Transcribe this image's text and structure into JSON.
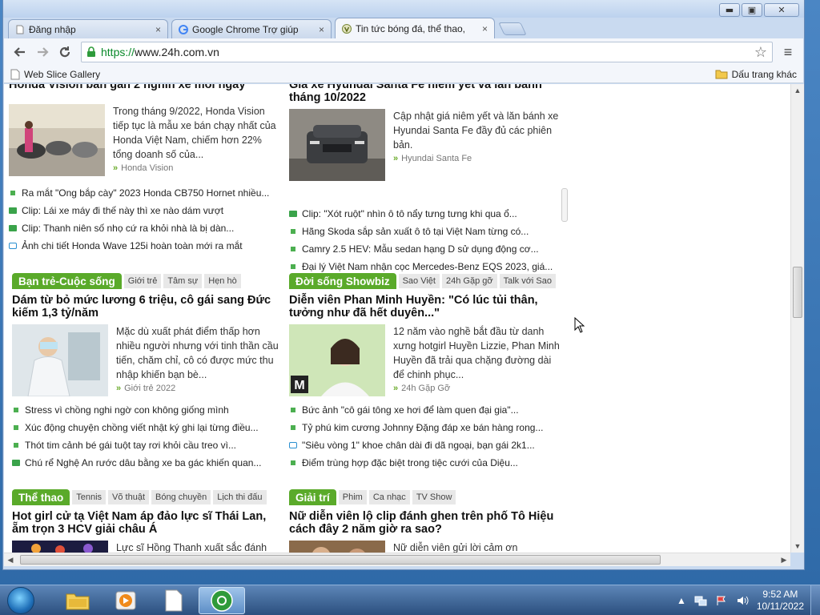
{
  "browser": {
    "tabs": [
      {
        "title": "Đăng nhập",
        "close": "×"
      },
      {
        "title": "Google Chrome Trợ giúp",
        "close": "×"
      },
      {
        "title": "Tin tức bóng đá, thể thao,",
        "close": "×"
      }
    ],
    "url": {
      "scheme": "https://",
      "host": "www.24h.com.vn"
    },
    "bookmarks": {
      "left": "Web Slice Gallery",
      "right": "Dấu trang khác"
    },
    "window_controls": {
      "min": "▬",
      "max": "▣",
      "close": "✕"
    }
  },
  "page": {
    "left_top": {
      "cut_title": "Honda Vision bán gần 2 nghìn xe mỗi ngày",
      "lead": "Trong tháng 9/2022, Honda Vision tiếp tục là mẫu xe bán chạy nhất của Honda Việt Nam, chiếm hơn 22% tổng doanh số của...",
      "tag": "Honda Vision",
      "links": [
        "Ra mắt \"Ong bắp cày\" 2023 Honda CB750 Hornet nhiều...",
        "Clip: Lái xe máy đi thế này thì xe nào dám vượt",
        "Clip: Thanh niên số nhọ cứ ra khỏi nhà là bị dàn...",
        "Ảnh chi tiết Honda Wave 125i hoàn toàn mới ra mắt"
      ]
    },
    "right_top": {
      "cut_title_1": "Giá xe Hyundai Santa Fe niêm yết và lăn bánh",
      "cut_title_2": "tháng 10/2022",
      "lead": "Cập nhật giá niêm yết và lăn bánh xe Hyundai Santa Fe đầy đủ các phiên bản.",
      "tag": "Hyundai Santa Fe",
      "links": [
        "Clip: \"Xót ruột\" nhìn ô tô nẩy tưng tưng khi qua ổ...",
        "Hãng Skoda sắp sản xuất ô tô tại Việt Nam từng có...",
        "Camry 2.5 HEV: Mẫu sedan hạng D sử dụng động cơ...",
        "Đại lý Việt Nam nhận cọc Mercedes-Benz EQS 2023, giá..."
      ]
    },
    "left_mid": {
      "section": "Bạn trẻ-Cuộc sống",
      "subtabs": [
        "Giới trẻ",
        "Tâm sự",
        "Hẹn hò"
      ],
      "headline": "Dám từ bỏ mức lương 6 triệu, cô gái sang Đức kiếm 1,3 tỷ/năm",
      "lead": "Mặc dù xuất phát điểm thấp hơn nhiều người nhưng với tinh thần cầu tiến, chăm chỉ, cô có được mức thu nhập khiến bạn bè...",
      "tag": "Giới trẻ 2022",
      "links": [
        "Stress vì chồng nghi ngờ con không giống mình",
        "Xúc động chuyện chồng viết nhật ký ghi lại từng điều...",
        "Thót tim cảnh bé gái tuột tay rơi khỏi cầu treo vì...",
        "Chú rể Nghệ An rước dâu bằng xe ba gác khiến quan..."
      ]
    },
    "right_mid": {
      "section": "Đời sống Showbiz",
      "subtabs": [
        "Sao Việt",
        "24h Gặp gỡ",
        "Talk với Sao"
      ],
      "headline": "Diễn viên Phan Minh Huyền: \"Có lúc tủi thân, tưởng như đã hết duyên...\"",
      "lead": "12 năm vào nghề bắt đầu từ danh xưng hotgirl Huyền Lizzie, Phan Minh Huyền đã trải qua chặng đường dài để chinh phục...",
      "tag": "24h Gặp Gỡ",
      "links": [
        "Bức ảnh \"cô gái tông xe hơi để làm quen đại gia\"...",
        "Tỷ phú kim cương Johnny Đặng đáp xe bán hàng rong...",
        "\"Siêu vòng 1\" khoe chân dài đi dã ngoại, bạn gái 2k1...",
        "Điểm trùng hợp đặc biệt trong tiệc cưới của Diệu..."
      ]
    },
    "left_bottom": {
      "section": "Thể thao",
      "subtabs": [
        "Tennis",
        "Võ thuật",
        "Bóng chuyền",
        "Lịch thi đấu"
      ],
      "headline": "Hot girl cử tạ Việt Nam áp đảo lực sĩ Thái Lan, ẵm trọn 3 HCV giải châu Á",
      "lead": "Lực sĩ Hồng Thanh xuất sắc đánh"
    },
    "right_bottom": {
      "section": "Giải trí",
      "subtabs": [
        "Phim",
        "Ca nhạc",
        "TV Show"
      ],
      "headline": "Nữ diễn viên lộ clip đánh ghen trên phố Tô Hiệu cách đây 2 năm giờ ra sao?",
      "lead": "Nữ diễn viên gửi lời cảm ơn"
    }
  },
  "taskbar": {
    "time": "9:52 AM",
    "date": "10/11/2022"
  }
}
